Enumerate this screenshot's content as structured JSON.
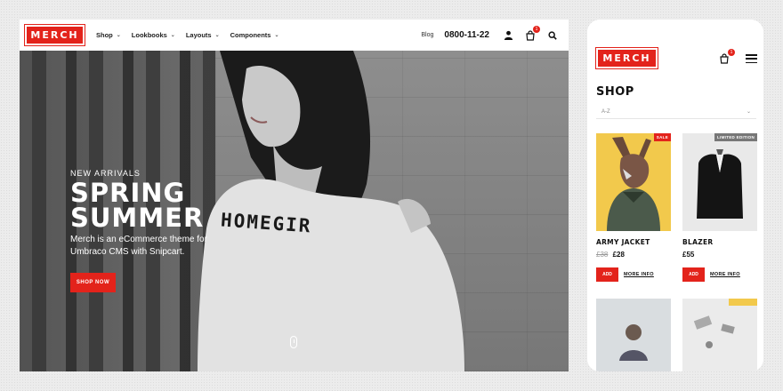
{
  "desktop": {
    "logo": "MERCH",
    "nav": [
      {
        "label": "Shop"
      },
      {
        "label": "Lookbooks"
      },
      {
        "label": "Layouts"
      },
      {
        "label": "Components"
      }
    ],
    "blog_label": "Blog",
    "phone": "0800-11-22",
    "cart_count": "1",
    "hero": {
      "eyebrow": "NEW ARRIVALS",
      "title_line1": "SPRING",
      "title_line2": "SUMMER",
      "description": "Merch is an eCommerce theme for Umbraco CMS with Snipcart.",
      "button": "SHOP NOW",
      "sweater_text": "HOMEGIR"
    }
  },
  "mobile": {
    "logo": "MERCH",
    "cart_count": "1",
    "page_title": "SHOP",
    "sort_value": "A-Z",
    "products": [
      {
        "name": "ARMY JACKET",
        "old_price": "£38",
        "price": "£28",
        "tag": "SALE",
        "add": "ADD",
        "more": "MORE INFO"
      },
      {
        "name": "BLAZER",
        "old_price": "",
        "price": "£55",
        "tag": "LIMITED EDITION",
        "add": "ADD",
        "more": "MORE INFO"
      }
    ]
  },
  "colors": {
    "brand_red": "#e3231b",
    "text_dark": "#111111",
    "card_yellow": "#f2c94c"
  }
}
